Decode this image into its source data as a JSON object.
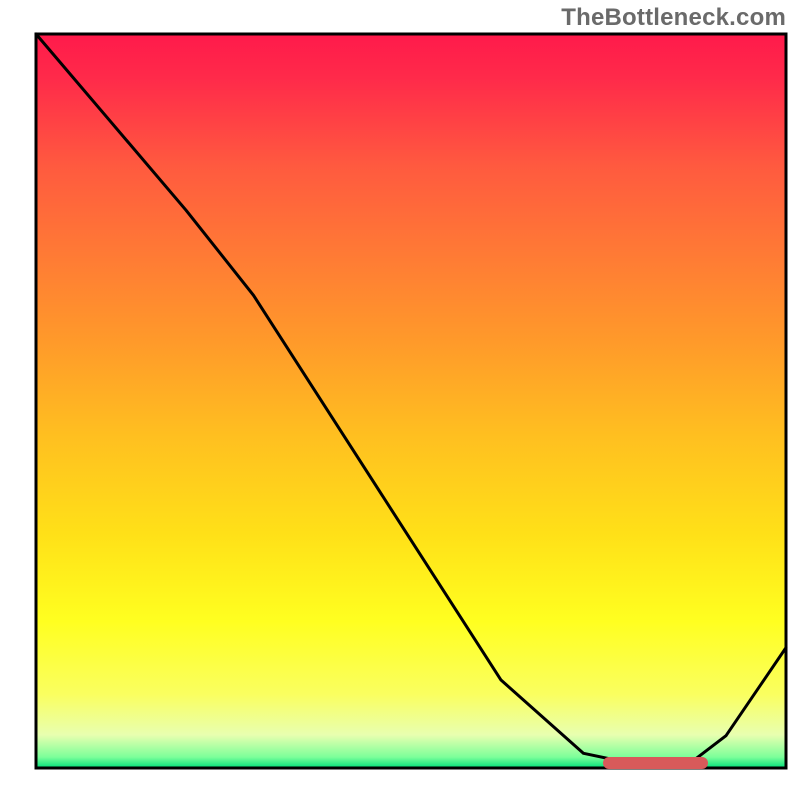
{
  "watermark": "TheBottleneck.com",
  "colors": {
    "gradient_top": "#ff1a4b",
    "gradient_mid": "#ffe018",
    "gradient_bottom": "#00e07a",
    "curve": "#000000",
    "marker": "#d85a5a",
    "frame": "#000000",
    "watermark_text": "#6a6a6a"
  },
  "chart_data": {
    "type": "line",
    "title": "",
    "xlabel": "",
    "ylabel": "",
    "xlim": [
      0,
      100
    ],
    "ylim": [
      0,
      100
    ],
    "grid": false,
    "legend": false,
    "series": [
      {
        "name": "bottleneck_curve",
        "x": [
          0,
          10,
          20,
          29,
          40,
          51,
          62,
          73,
          80,
          87,
          92,
          100
        ],
        "y": [
          100,
          88,
          76,
          64.4,
          46.93,
          29.46,
          12,
          2.01,
          0.51,
          0.51,
          4.41,
          16.41
        ]
      }
    ],
    "annotations": [
      {
        "name": "optimal_range_marker",
        "shape": "bar",
        "x_range": [
          75.6,
          89.6
        ],
        "y": 0.85,
        "color": "#d85a5a"
      }
    ],
    "background_gradient": {
      "direction": "vertical",
      "stops": [
        {
          "pos": 0.0,
          "color": "#ff1a4b"
        },
        {
          "pos": 0.3,
          "color": "#ff7a35"
        },
        {
          "pos": 0.55,
          "color": "#ffc020"
        },
        {
          "pos": 0.8,
          "color": "#ffff20"
        },
        {
          "pos": 0.96,
          "color": "#e8ffb0"
        },
        {
          "pos": 1.0,
          "color": "#00e07a"
        }
      ]
    }
  }
}
